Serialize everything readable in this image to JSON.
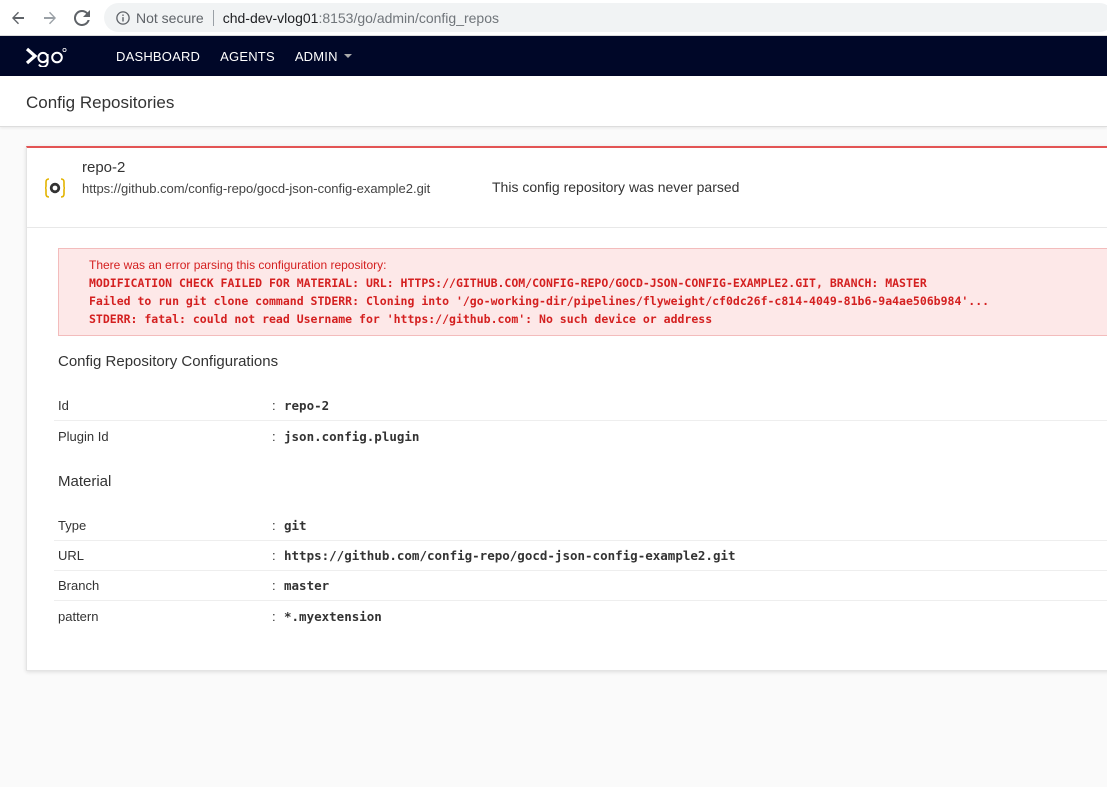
{
  "browser": {
    "security_label": "Not secure",
    "url_host": "chd-dev-vlog01",
    "url_path": ":8153/go/admin/config_repos"
  },
  "header": {
    "nav": [
      {
        "label": "DASHBOARD"
      },
      {
        "label": "AGENTS"
      },
      {
        "label": "ADMIN"
      }
    ]
  },
  "page": {
    "title": "Config Repositories"
  },
  "repo": {
    "name": "repo-2",
    "url": "https://github.com/config-repo/gocd-json-config-example2.git",
    "status": "This config repository was never parsed",
    "error": {
      "intro": "There was an error parsing this configuration repository:",
      "lines": [
        "MODIFICATION CHECK FAILED FOR MATERIAL: URL: HTTPS://GITHUB.COM/CONFIG-REPO/GOCD-JSON-CONFIG-EXAMPLE2.GIT, BRANCH: MASTER",
        "Failed to run git clone command STDERR: Cloning into '/go-working-dir/pipelines/flyweight/cf0dc26f-c814-4049-81b6-9a4ae506b984'...",
        "STDERR: fatal: could not read Username for 'https://github.com': No such device or address"
      ]
    },
    "config_section": {
      "title": "Config Repository Configurations",
      "rows": [
        {
          "key": "Id",
          "value": "repo-2"
        },
        {
          "key": "Plugin Id",
          "value": "json.config.plugin"
        }
      ]
    },
    "material_section": {
      "title": "Material",
      "rows": [
        {
          "key": "Type",
          "value": "git"
        },
        {
          "key": "URL",
          "value": "https://github.com/config-repo/gocd-json-config-example2.git"
        },
        {
          "key": "Branch",
          "value": "master"
        },
        {
          "key": "pattern",
          "value": "*.myextension"
        }
      ]
    }
  },
  "colors": {
    "header_bg": "#000728",
    "error_text": "#d42020",
    "error_bg": "#fde8e8",
    "card_accent": "#e35454"
  }
}
